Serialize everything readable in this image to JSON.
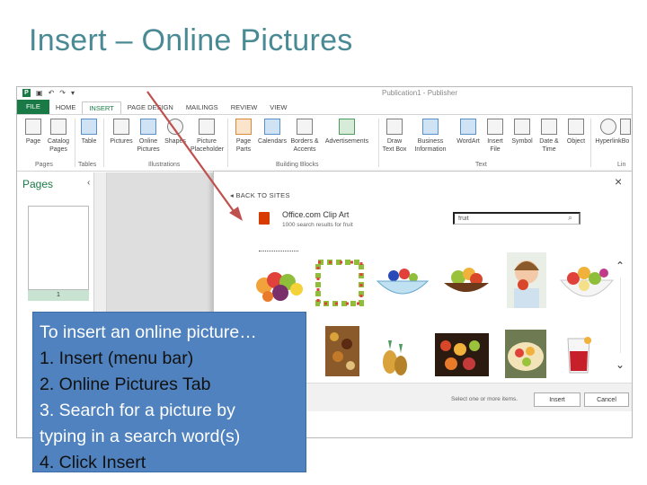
{
  "slide": {
    "title": "Insert – Online Pictures"
  },
  "window": {
    "title": "Publication1 - Publisher"
  },
  "tabs": [
    "HOME",
    "INSERT",
    "PAGE DESIGN",
    "MAILINGS",
    "REVIEW",
    "VIEW"
  ],
  "file_tab": "FILE",
  "ribbon": {
    "page": "Page",
    "catalog_pages": [
      "Catalog",
      "Pages"
    ],
    "table": "Table",
    "pictures": "Pictures",
    "online_pictures": [
      "Online",
      "Pictures"
    ],
    "shapes": "Shapes",
    "picture_placeholder": [
      "Picture",
      "Placeholder"
    ],
    "page_parts": [
      "Page",
      "Parts"
    ],
    "calendars": "Calendars",
    "borders_accents": [
      "Borders &",
      "Accents"
    ],
    "advertisements": "Advertisements",
    "draw_text_box": [
      "Draw",
      "Text Box"
    ],
    "business_information": [
      "Business",
      "Information"
    ],
    "wordart": "WordArt",
    "insert_file": [
      "Insert",
      "File"
    ],
    "symbol": "Symbol",
    "date_time": [
      "Date &",
      "Time"
    ],
    "object": "Object",
    "hyperlink": "Hyperlink",
    "bookmark": "Bo",
    "groups": {
      "pages": "Pages",
      "tables": "Tables",
      "illustrations": "Illustrations",
      "building_blocks": "Building Blocks",
      "text": "Text",
      "links": "Lin"
    }
  },
  "pages_pane": {
    "title": "Pages",
    "page_number": "1"
  },
  "dialog": {
    "back": "BACK TO SITES",
    "source": "Office.com Clip Art",
    "result_count": "1000 search results for fruit",
    "search_value": "fruit",
    "footer_note": "Select one or more items.",
    "insert_label": "Insert",
    "cancel_label": "Cancel"
  },
  "callout": {
    "lines": [
      "To insert an online picture…",
      "1. Insert (menu bar)",
      "2. Online Pictures Tab",
      "3. Search for a picture by",
      "typing in a search word(s)",
      "4. Click Insert"
    ]
  },
  "colors": {
    "title": "#4a8a95",
    "publisher_green": "#1a7a46",
    "callout_bg": "#4f82be",
    "arrow": "#c0504d",
    "office_red": "#d83b01"
  }
}
